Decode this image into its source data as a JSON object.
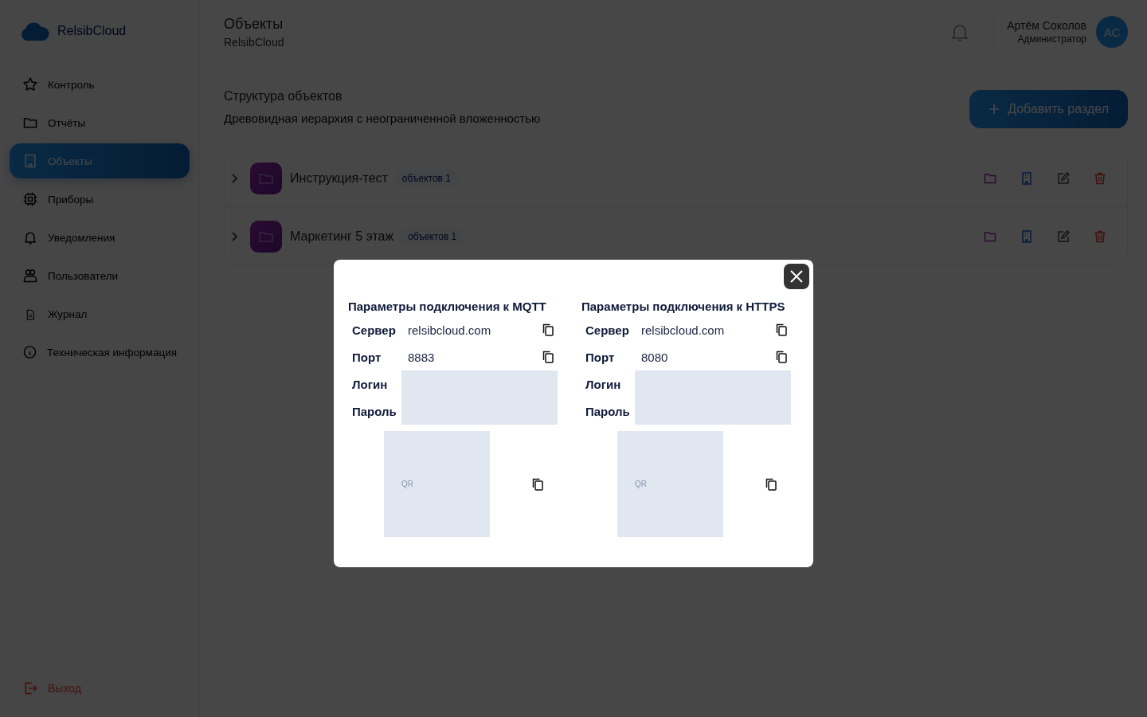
{
  "logo": "RelsibCloud",
  "sidebar": {
    "items": [
      {
        "label": "Контроль",
        "kind": "star",
        "selected": false
      },
      {
        "label": "Отчёты",
        "kind": "folder",
        "selected": false
      },
      {
        "label": "Объекты",
        "kind": "building",
        "selected": true
      },
      {
        "label": "Приборы",
        "kind": "chip",
        "selected": false
      },
      {
        "label": "Уведомления",
        "kind": "bell",
        "selected": false
      },
      {
        "label": "Пользователи",
        "kind": "users",
        "selected": false
      },
      {
        "label": "Журнал",
        "kind": "file",
        "selected": false
      },
      {
        "label": "Техническая информация",
        "kind": "info",
        "selected": false
      }
    ],
    "logout": "Выход"
  },
  "header": {
    "title": "Объекты",
    "subtitle": "RelsibCloud",
    "user": {
      "name": "Артём Соколов",
      "role": "Администратор",
      "initials": "АС"
    }
  },
  "section": {
    "title": "Структура объектов",
    "description": "Древовидная иерархия с неограниченной вложенностью",
    "add_button": "Добавить раздел"
  },
  "tree": [
    {
      "name": "Инструкция-тест",
      "badge": "объектов 1",
      "expanded": false
    },
    {
      "name": "Маркетинг 5 этаж",
      "badge": "объектов 1",
      "expanded": false
    }
  ],
  "modal": {
    "columns": [
      {
        "title": "Параметры подключения к MQTT",
        "fields": [
          {
            "label": "Сервер",
            "kind": "text",
            "value": "relsibcloud.com"
          },
          {
            "label": "Порт",
            "kind": "text",
            "value": "8883"
          },
          {
            "label": "Логин",
            "kind": "hidden"
          },
          {
            "label": "Пароль",
            "kind": "hidden"
          }
        ],
        "qr_label": "QR"
      },
      {
        "title": "Параметры подключения к HTTPS",
        "fields": [
          {
            "label": "Сервер",
            "kind": "text",
            "value": "relsibcloud.com"
          },
          {
            "label": "Порт",
            "kind": "text",
            "value": "8080"
          },
          {
            "label": "Логин",
            "kind": "hidden"
          },
          {
            "label": "Пароль",
            "kind": "hidden"
          }
        ],
        "qr_label": "QR"
      }
    ]
  }
}
